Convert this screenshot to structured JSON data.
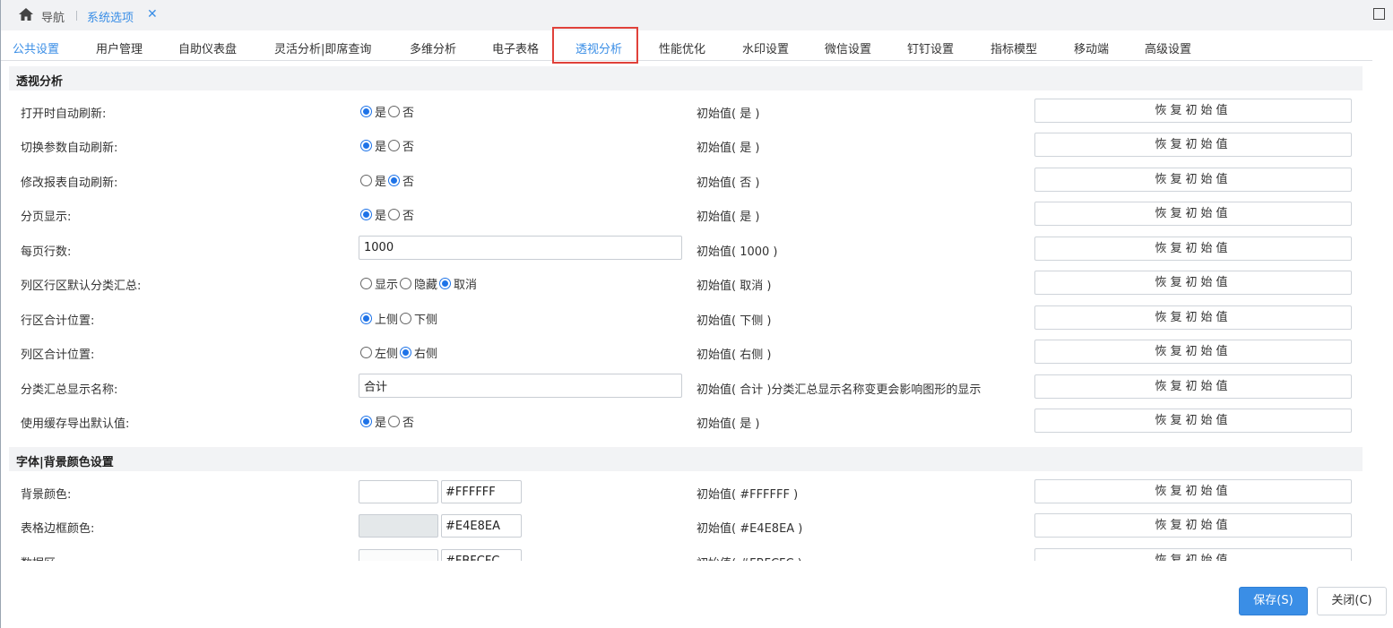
{
  "nav": {
    "home_label": "导航",
    "tab_label": "系统选项"
  },
  "tabs": [
    "公共设置",
    "用户管理",
    "自助仪表盘",
    "灵活分析|即席查询",
    "多维分析",
    "电子表格",
    "透视分析",
    "性能优化",
    "水印设置",
    "微信设置",
    "钉钉设置",
    "指标模型",
    "移动端",
    "高级设置"
  ],
  "active_tab": "透视分析",
  "sections": {
    "pivot_title": "透视分析",
    "font_title": "字体|背景颜色设置"
  },
  "reset_label": "恢复初始值",
  "rows": [
    {
      "label": "打开时自动刷新:",
      "options": [
        "是",
        "否"
      ],
      "selected": 0,
      "initial": "初始值( 是 )"
    },
    {
      "label": "切换参数自动刷新:",
      "options": [
        "是",
        "否"
      ],
      "selected": 0,
      "initial": "初始值( 是 )"
    },
    {
      "label": "修改报表自动刷新:",
      "options": [
        "是",
        "否"
      ],
      "selected": 1,
      "initial": "初始值( 否 )"
    },
    {
      "label": "分页显示:",
      "options": [
        "是",
        "否"
      ],
      "selected": 0,
      "initial": "初始值( 是 )"
    },
    {
      "label": "每页行数:",
      "value": "1000",
      "initial": "初始值( 1000 )"
    },
    {
      "label": "列区行区默认分类汇总:",
      "options": [
        "显示",
        "隐藏",
        "取消"
      ],
      "selected": 2,
      "initial": "初始值( 取消 )"
    },
    {
      "label": "行区合计位置:",
      "options": [
        "上侧",
        "下侧"
      ],
      "selected": 0,
      "initial": "初始值( 下侧 )"
    },
    {
      "label": "列区合计位置:",
      "options": [
        "左侧",
        "右侧"
      ],
      "selected": 1,
      "initial": "初始值( 右侧 )"
    },
    {
      "label": "分类汇总显示名称:",
      "value": "合计",
      "initial": "初始值( 合计 )分类汇总显示名称变更会影响图形的显示"
    },
    {
      "label": "使用缓存导出默认值:",
      "options": [
        "是",
        "否"
      ],
      "selected": 0,
      "initial": "初始值( 是 )"
    }
  ],
  "color_rows": [
    {
      "label": "背景颜色:",
      "color": "#FFFFFF",
      "value": "#FFFFFF",
      "initial": "初始值( #FFFFFF )"
    },
    {
      "label": "表格边框颜色:",
      "color": "#E4E8EA",
      "value": "#E4E8EA",
      "initial": "初始值( #E4E8EA )"
    },
    {
      "label": "数据区:",
      "color": "#FBFCFC",
      "value": "#FBFCFC",
      "initial": "初始值( #FBFCFC )"
    }
  ],
  "footer": {
    "save_label": "保存(S)",
    "close_label": "关闭(C)"
  },
  "colors": {
    "accent": "#3a8ee6",
    "highlight": "#e0413a"
  }
}
